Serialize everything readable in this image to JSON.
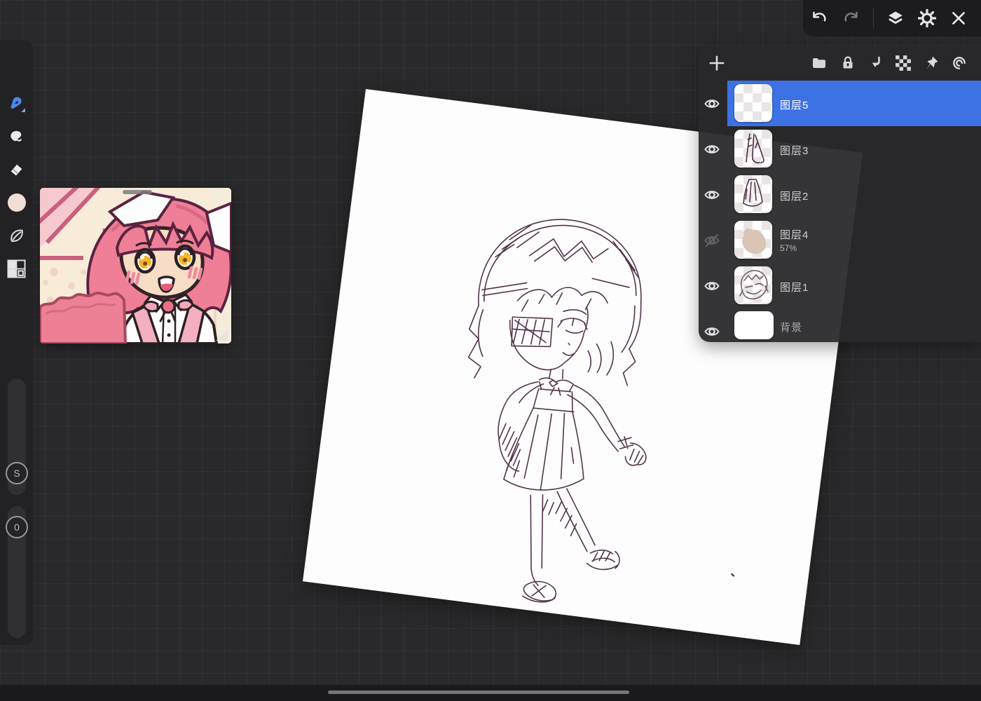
{
  "topbar": {
    "icons": [
      {
        "name": "undo"
      },
      {
        "name": "redo"
      },
      {
        "name": "layers"
      },
      {
        "name": "settings"
      },
      {
        "name": "close"
      }
    ]
  },
  "toolbar": {
    "tools": [
      {
        "name": "brush",
        "selected": true
      },
      {
        "name": "smudge",
        "selected": false
      },
      {
        "name": "eraser",
        "selected": false
      },
      {
        "name": "color-swatch",
        "selected": false
      },
      {
        "name": "leaf",
        "selected": false
      },
      {
        "name": "pattern-grid",
        "selected": false
      }
    ],
    "size_slider": {
      "label": "S"
    },
    "opacity_slider": {
      "label": "0"
    }
  },
  "layers_panel": {
    "header_icons": [
      "add-layer",
      "folder",
      "lock",
      "merge-down",
      "transparency",
      "pin",
      "spiral"
    ],
    "items": [
      {
        "name": "图层5",
        "visible": true,
        "selected": true,
        "thumb": "transparent"
      },
      {
        "name": "图层3",
        "visible": true,
        "selected": false,
        "thumb": "legs-sketch"
      },
      {
        "name": "图层2",
        "visible": true,
        "selected": false,
        "thumb": "dress-sketch"
      },
      {
        "name": "图层4",
        "visible": false,
        "selected": false,
        "thumb": "skin-blob",
        "opacity": "57%"
      },
      {
        "name": "图层1",
        "visible": true,
        "selected": false,
        "thumb": "head-sketch"
      },
      {
        "name": "背景",
        "visible": true,
        "selected": false,
        "thumb": "white"
      }
    ]
  },
  "colors": {
    "selection_blue": "#3c72e3",
    "tool_accent": "#4e87ea",
    "current_color": "#f1ded6",
    "sketch_line": "#44233c",
    "background": "#29292b"
  }
}
